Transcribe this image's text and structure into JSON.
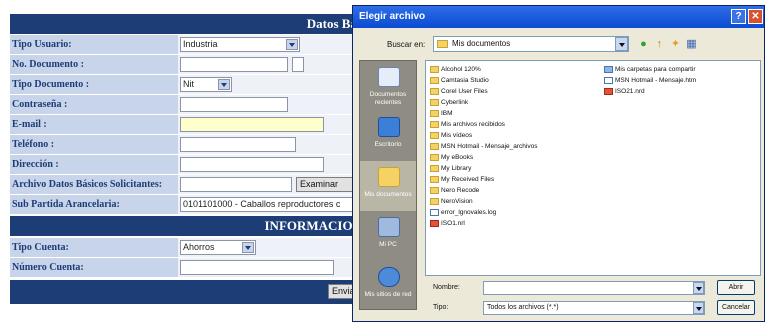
{
  "form": {
    "header_title": "Datos Bás",
    "section_title": "INFORMACION",
    "fields": {
      "tipo_usuario": {
        "label": "Tipo Usuario:",
        "value": "Industria"
      },
      "no_documento": {
        "label": "No. Documento :"
      },
      "tipo_documento": {
        "label": "Tipo Documento :",
        "value": "Nit"
      },
      "contrasena": {
        "label": "Contraseña :"
      },
      "email": {
        "label": "E-mail :"
      },
      "telefono": {
        "label": "Teléfono :"
      },
      "direccion": {
        "label": "Dirección :"
      },
      "archivo": {
        "label": "Archivo Datos Básicos Solicitantes:",
        "button": "Examinar"
      },
      "sub_partida": {
        "label": "Sub Partida Arancelaria:",
        "value": "0101101000 - Caballos reproductores c"
      },
      "tipo_cuenta": {
        "label": "Tipo Cuenta:",
        "value": "Ahorros"
      },
      "numero_cuenta": {
        "label": "Número Cuenta:"
      }
    },
    "footer_button": "Envia"
  },
  "dialog": {
    "title": "Elegir archivo",
    "help_glyph": "?",
    "close_glyph": "✕",
    "look_in_label": "Buscar en:",
    "look_in_value": "Mis documentos",
    "toolbar": {
      "back": "●",
      "up": "↑",
      "new_folder": "✦",
      "views": "▦"
    },
    "places": [
      {
        "label": "Documentos recientes"
      },
      {
        "label": "Escritorio"
      },
      {
        "label": "Mis documentos"
      },
      {
        "label": "Mi PC"
      },
      {
        "label": "Mis sitios de red"
      }
    ],
    "files_col1": [
      {
        "name": "Alcohol 120%",
        "icon": "folder"
      },
      {
        "name": "Camtasia Studio",
        "icon": "folder"
      },
      {
        "name": "Corel User Files",
        "icon": "folder"
      },
      {
        "name": "Cyberlink",
        "icon": "folder"
      },
      {
        "name": "IBM",
        "icon": "folder"
      },
      {
        "name": "Mis archivos recibidos",
        "icon": "folder"
      },
      {
        "name": "Mis vídeos",
        "icon": "folder"
      },
      {
        "name": "MSN Hotmail - Mensaje_archivos",
        "icon": "folder"
      },
      {
        "name": "My eBooks",
        "icon": "folder"
      },
      {
        "name": "My Library",
        "icon": "folder"
      },
      {
        "name": "My Received Files",
        "icon": "folder"
      },
      {
        "name": "Nero Recode",
        "icon": "folder"
      },
      {
        "name": "NeroVision",
        "icon": "folder"
      },
      {
        "name": "error_lgnovales.log",
        "icon": "doc"
      },
      {
        "name": "ISO1.nrl",
        "icon": "red"
      }
    ],
    "files_col2": [
      {
        "name": "Mis carpetas para compartir",
        "icon": "share"
      },
      {
        "name": "MSN Hotmail - Mensaje.htm",
        "icon": "doc"
      },
      {
        "name": "ISO21.nrd",
        "icon": "red"
      }
    ],
    "filename_label": "Nombre:",
    "filename_value": "",
    "filetype_label": "Tipo:",
    "filetype_value": "Todos los archivos (*.*)",
    "open_button": "Abrir",
    "cancel_button": "Cancelar"
  }
}
